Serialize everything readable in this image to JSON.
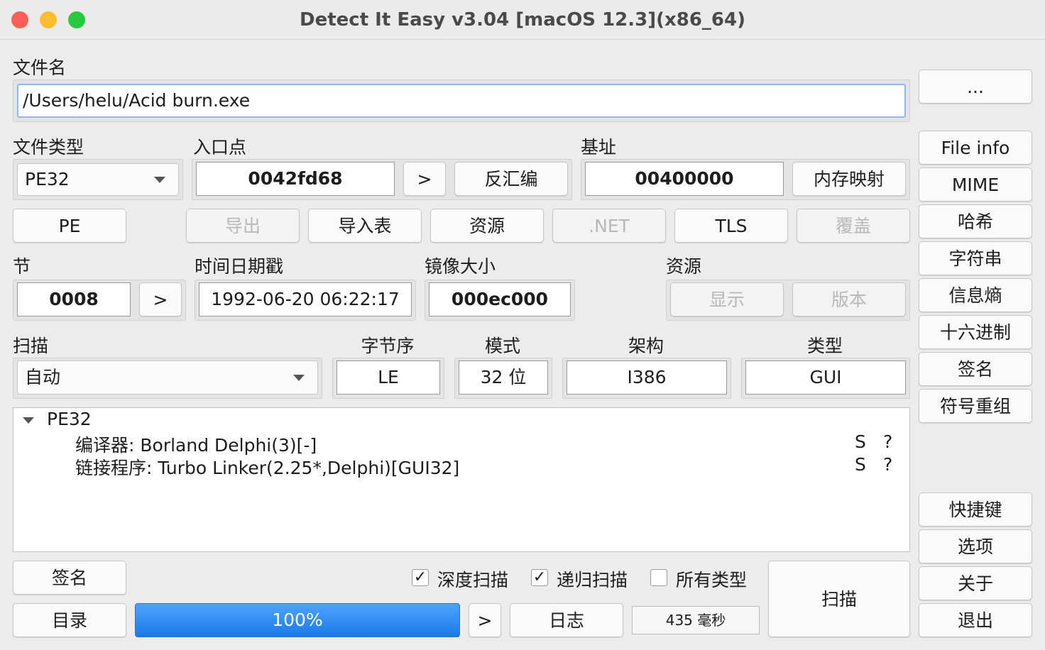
{
  "window": {
    "title": "Detect It Easy v3.04 [macOS 12.3](x86_64)"
  },
  "file": {
    "label": "文件名",
    "path": "/Users/helu/Acid burn.exe",
    "browse": "..."
  },
  "filetype": {
    "label": "文件类型",
    "value": "PE32"
  },
  "entry": {
    "label": "入口点",
    "value": "0042fd68",
    "go": ">",
    "disasm": "反汇编"
  },
  "base": {
    "label": "基址",
    "value": "00400000",
    "memmap": "内存映射"
  },
  "pe_buttons": {
    "pe": "PE",
    "export": "导出",
    "import": "导入表",
    "resource": "资源",
    "net": ".NET",
    "tls": "TLS",
    "overlay": "覆盖"
  },
  "section": {
    "label": "节",
    "value": "0008",
    "go": ">"
  },
  "timestamp": {
    "label": "时间日期戳",
    "value": "1992-06-20 06:22:17"
  },
  "image_size": {
    "label": "镜像大小",
    "value": "000ec000"
  },
  "resources": {
    "label": "资源",
    "show": "显示",
    "version": "版本"
  },
  "scan": {
    "label": "扫描",
    "mode": "自动"
  },
  "endian": {
    "label": "字节序",
    "value": "LE"
  },
  "mode": {
    "label": "模式",
    "value": "32 位"
  },
  "arch": {
    "label": "架构",
    "value": "I386"
  },
  "type": {
    "label": "类型",
    "value": "GUI"
  },
  "results": {
    "root": "PE32",
    "items": [
      {
        "text": "编译器: Borland Delphi(3)[-]",
        "s": "S",
        "q": "?"
      },
      {
        "text": "链接程序: Turbo Linker(2.25*,Delphi)[GUI32]",
        "s": "S",
        "q": "?"
      }
    ]
  },
  "bottom": {
    "signatures": "签名",
    "directory": "目录",
    "progress": "100%",
    "progress_value": 100,
    "go": ">",
    "log": "日志",
    "time": "435 毫秒",
    "scan": "扫描",
    "deep": {
      "label": "深度扫描",
      "checked": true
    },
    "recursive": {
      "label": "递归扫描",
      "checked": true
    },
    "alltypes": {
      "label": "所有类型",
      "checked": false
    }
  },
  "side": {
    "fileinfo": "File info",
    "mime": "MIME",
    "hash": "哈希",
    "strings": "字符串",
    "entropy": "信息熵",
    "hex": "十六进制",
    "signature": "签名",
    "demangle": "符号重组",
    "shortcuts": "快捷键",
    "options": "选项",
    "about": "关于",
    "exit": "退出"
  },
  "colors": {
    "red": "#fe5f57",
    "yellow": "#febc2e",
    "green": "#28c840",
    "progress": "#1a7ae8"
  }
}
